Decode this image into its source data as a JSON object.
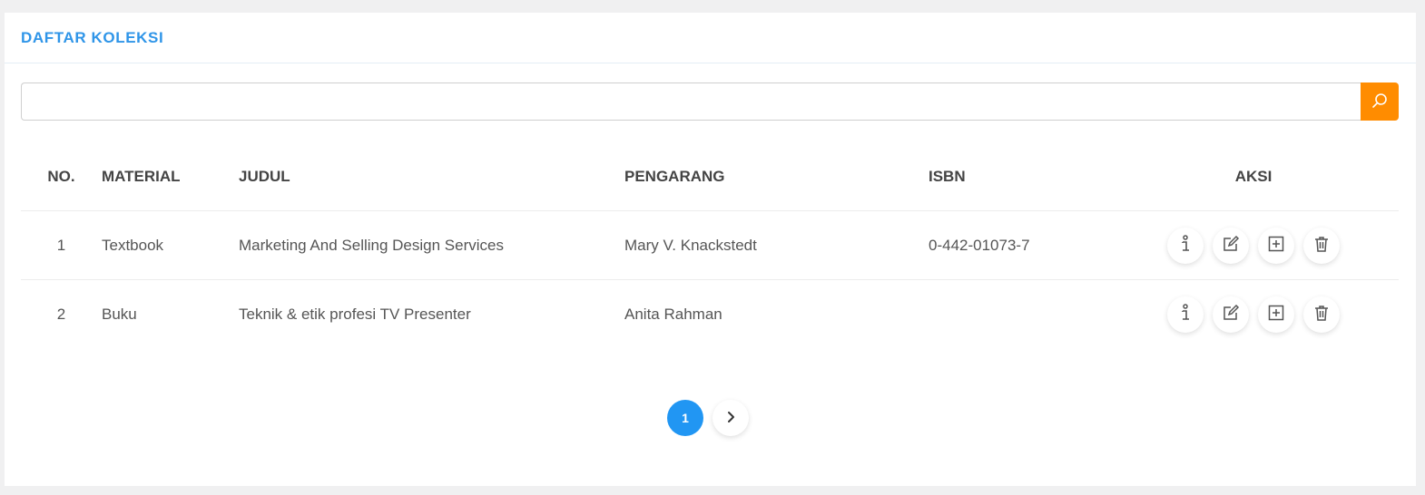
{
  "panel": {
    "title": "DAFTAR KOLEKSI"
  },
  "search": {
    "value": "",
    "placeholder": "",
    "button_icon": "search-icon",
    "button_color": "#ff8c00"
  },
  "table": {
    "headers": [
      "NO.",
      "MATERIAL",
      "JUDUL",
      "PENGARANG",
      "ISBN",
      "AKSI"
    ],
    "rows": [
      {
        "no": "1",
        "material": "Textbook",
        "judul": "Marketing And Selling Design Services",
        "pengarang": "Mary V. Knackstedt",
        "isbn": "0-442-01073-7"
      },
      {
        "no": "2",
        "material": "Buku",
        "judul": "Teknik & etik profesi TV Presenter",
        "pengarang": "Anita Rahman",
        "isbn": ""
      }
    ],
    "action_icons": [
      "info-icon",
      "edit-icon",
      "add-icon",
      "trash-icon"
    ]
  },
  "pagination": {
    "current_page": "1",
    "next_icon": "chevron-right-icon",
    "active_color": "#2196f3"
  },
  "colors": {
    "title": "#2f95e8",
    "accent_orange": "#ff8c00",
    "accent_blue": "#2196f3"
  }
}
